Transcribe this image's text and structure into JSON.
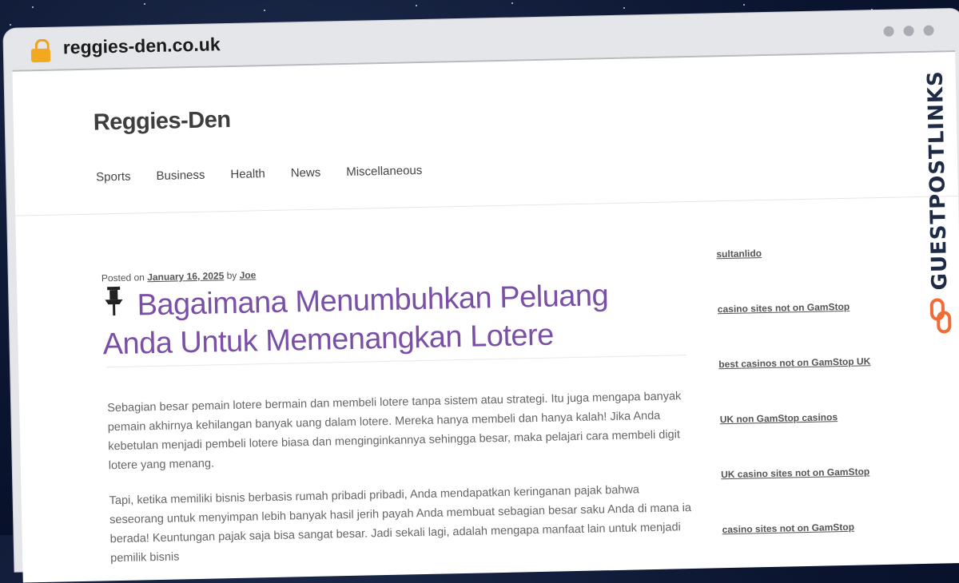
{
  "browser": {
    "url": "reggies-den.co.uk"
  },
  "site": {
    "title": "Reggies-Den",
    "nav": [
      "Sports",
      "Business",
      "Health",
      "News",
      "Miscellaneous"
    ]
  },
  "post": {
    "posted_on_label": "Posted on",
    "date": "January 16, 2025",
    "by_label": "by",
    "author": "Joe",
    "title": "Bagaimana Menumbuhkan Peluang Anda Untuk Memenangkan Lotere",
    "paragraphs": [
      "Sebagian besar pemain lotere bermain dan membeli lotere tanpa sistem atau strategi. Itu juga mengapa banyak pemain akhirnya kehilangan banyak uang dalam lotere. Mereka hanya membeli dan hanya kalah! Jika Anda kebetulan menjadi pembeli lotere biasa dan menginginkannya sehingga besar, maka pelajari cara membeli digit lotere yang menang.",
      "Tapi, ketika memiliki bisnis berbasis rumah pribadi pribadi, Anda mendapatkan keringanan pajak bahwa seseorang untuk menyimpan lebih banyak hasil jerih payah Anda membuat sebagian besar saku Anda di mana ia berada! Keuntungan pajak saja bisa sangat besar. Jadi sekali lagi, adalah mengapa manfaat lain untuk menjadi pemilik bisnis"
    ]
  },
  "sidebar": {
    "links": [
      "sultanlido",
      "casino sites not on GamStop",
      "best casinos not on GamStop UK",
      "UK non GamStop casinos",
      "UK casino sites not on GamStop",
      "casino sites not on GamStop"
    ]
  },
  "branding": {
    "watermark": "GUESTPOSTLINKS",
    "accent_color": "#f26a35"
  }
}
